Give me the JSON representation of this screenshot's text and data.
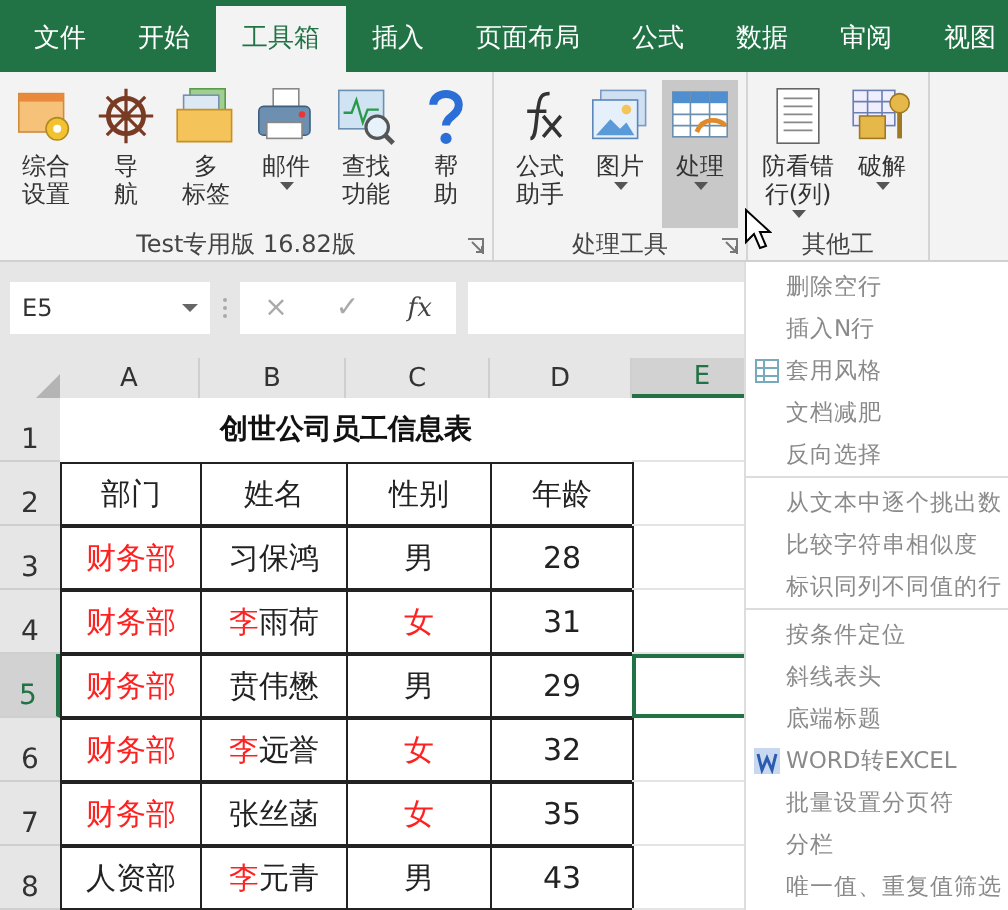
{
  "tabs": [
    {
      "label": "文件",
      "selected": false
    },
    {
      "label": "开始",
      "selected": false
    },
    {
      "label": "工具箱",
      "selected": true
    },
    {
      "label": "插入",
      "selected": false
    },
    {
      "label": "页面布局",
      "selected": false
    },
    {
      "label": "公式",
      "selected": false
    },
    {
      "label": "数据",
      "selected": false
    },
    {
      "label": "审阅",
      "selected": false
    },
    {
      "label": "视图",
      "selected": false
    }
  ],
  "ribbon_groups": [
    {
      "label": "Test专用版 16.82版",
      "launcher": true,
      "buttons": [
        {
          "lines": [
            "综合",
            "设置"
          ],
          "dropdown": false,
          "pressed": false
        },
        {
          "lines": [
            "导",
            "航"
          ],
          "dropdown": false,
          "pressed": false
        },
        {
          "lines": [
            "多",
            "标签"
          ],
          "dropdown": false,
          "pressed": false
        },
        {
          "lines": [
            "邮件"
          ],
          "dropdown": true,
          "pressed": false
        },
        {
          "lines": [
            "查找",
            "功能"
          ],
          "dropdown": false,
          "pressed": false
        },
        {
          "lines": [
            "帮",
            "助"
          ],
          "dropdown": false,
          "pressed": false
        }
      ]
    },
    {
      "label": "处理工具",
      "launcher": true,
      "buttons": [
        {
          "lines": [
            "公式",
            "助手"
          ],
          "dropdown": false,
          "pressed": false
        },
        {
          "lines": [
            "图片"
          ],
          "dropdown": true,
          "pressed": false
        },
        {
          "lines": [
            "处理"
          ],
          "dropdown": true,
          "pressed": true
        }
      ]
    },
    {
      "label": "其他工",
      "launcher": false,
      "buttons": [
        {
          "lines": [
            "防看错",
            "行(列)"
          ],
          "dropdown": true,
          "pressed": false
        },
        {
          "lines": [
            "破解"
          ],
          "dropdown": true,
          "pressed": false
        }
      ]
    }
  ],
  "formula_bar": {
    "name_box": "E5",
    "cancel": "×",
    "enter": "✓",
    "fx": "fx"
  },
  "sheet": {
    "columns": [
      {
        "label": "A",
        "selected": false
      },
      {
        "label": "B",
        "selected": false
      },
      {
        "label": "C",
        "selected": false
      },
      {
        "label": "D",
        "selected": false
      },
      {
        "label": "E",
        "selected": true
      }
    ],
    "title_row": {
      "number": "1",
      "selected": false,
      "title": "创世公司员工信息表"
    },
    "rows": [
      {
        "number": "2",
        "selected": false,
        "cells": [
          [
            {
              "text": "部门",
              "red": false
            }
          ],
          [
            {
              "text": "姓名",
              "red": false
            }
          ],
          [
            {
              "text": "性别",
              "red": false
            }
          ],
          [
            {
              "text": "年龄",
              "red": false
            }
          ]
        ]
      },
      {
        "number": "3",
        "selected": false,
        "cells": [
          [
            {
              "text": "财务部",
              "red": true
            }
          ],
          [
            {
              "text": "习保鸿",
              "red": false
            }
          ],
          [
            {
              "text": "男",
              "red": false
            }
          ],
          [
            {
              "text": "28",
              "red": false
            }
          ]
        ]
      },
      {
        "number": "4",
        "selected": false,
        "cells": [
          [
            {
              "text": "财务部",
              "red": true
            }
          ],
          [
            {
              "text": "李",
              "red": true
            },
            {
              "text": "雨荷",
              "red": false
            }
          ],
          [
            {
              "text": "女",
              "red": true
            }
          ],
          [
            {
              "text": "31",
              "red": false
            }
          ]
        ]
      },
      {
        "number": "5",
        "selected": true,
        "cells": [
          [
            {
              "text": "财务部",
              "red": true
            }
          ],
          [
            {
              "text": "贲伟懋",
              "red": false
            }
          ],
          [
            {
              "text": "男",
              "red": false
            }
          ],
          [
            {
              "text": "29",
              "red": false
            }
          ]
        ]
      },
      {
        "number": "6",
        "selected": false,
        "cells": [
          [
            {
              "text": "财务部",
              "red": true
            }
          ],
          [
            {
              "text": "李",
              "red": true
            },
            {
              "text": "远誉",
              "red": false
            }
          ],
          [
            {
              "text": "女",
              "red": true
            }
          ],
          [
            {
              "text": "32",
              "red": false
            }
          ]
        ]
      },
      {
        "number": "7",
        "selected": false,
        "cells": [
          [
            {
              "text": "财务部",
              "red": true
            }
          ],
          [
            {
              "text": "张丝菡",
              "red": false
            }
          ],
          [
            {
              "text": "女",
              "red": true
            }
          ],
          [
            {
              "text": "35",
              "red": false
            }
          ]
        ]
      },
      {
        "number": "8",
        "selected": false,
        "cells": [
          [
            {
              "text": "人资部",
              "red": false
            }
          ],
          [
            {
              "text": "李",
              "red": true
            },
            {
              "text": "元青",
              "red": false
            }
          ],
          [
            {
              "text": "男",
              "red": false
            }
          ],
          [
            {
              "text": "43",
              "red": false
            }
          ]
        ]
      }
    ]
  },
  "menu": {
    "items": [
      {
        "label": "删除空行",
        "has_icon": false,
        "separator_after": false
      },
      {
        "label": "插入N行",
        "has_icon": false,
        "separator_after": false
      },
      {
        "label": "套用风格",
        "has_icon": true,
        "separator_after": false
      },
      {
        "label": "文档减肥",
        "has_icon": false,
        "separator_after": false
      },
      {
        "label": "反向选择",
        "has_icon": false,
        "separator_after": true
      },
      {
        "label": "从文本中逐个挑出数",
        "has_icon": false,
        "separator_after": false
      },
      {
        "label": "比较字符串相似度",
        "has_icon": false,
        "separator_after": false
      },
      {
        "label": "标识同列不同值的行",
        "has_icon": false,
        "separator_after": true
      },
      {
        "label": "按条件定位",
        "has_icon": false,
        "separator_after": false
      },
      {
        "label": "斜线表头",
        "has_icon": false,
        "separator_after": false
      },
      {
        "label": "底端标题",
        "has_icon": false,
        "separator_after": false
      },
      {
        "label": "WORD转EXCEL",
        "has_icon": true,
        "separator_after": false
      },
      {
        "label": "批量设置分页符",
        "has_icon": false,
        "separator_after": false
      },
      {
        "label": "分栏",
        "has_icon": false,
        "separator_after": false
      },
      {
        "label": "唯一值、重复值筛选",
        "has_icon": false,
        "separator_after": false
      }
    ]
  }
}
